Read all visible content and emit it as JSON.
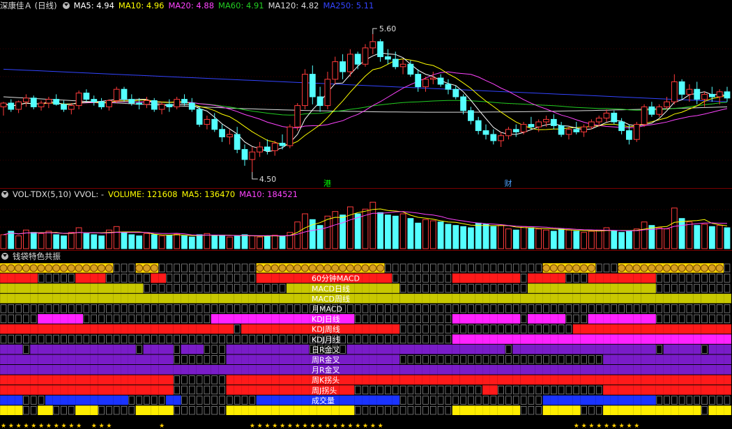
{
  "main_header": {
    "stock": "深康佳Ａ (日线)",
    "ma5": "MA5: 4.94",
    "ma10": "MA10: 4.96",
    "ma20": "MA20: 4.88",
    "ma60": "MA60: 4.91",
    "ma120": "MA120: 4.82",
    "ma250": "MA250: 5.11"
  },
  "price_high_label": "5.60",
  "price_low_label": "4.50",
  "event_markers": [
    {
      "label": "港",
      "index": 43,
      "color": "#00ff00"
    },
    {
      "label": "财",
      "index": 67,
      "color": "#4fa3ff"
    }
  ],
  "volume_header": {
    "name": "VOL-TDX(5,10)",
    "vvol": "VVOL: -",
    "volume": "VOLUME: 121608",
    "ma5": "MA5: 136470",
    "ma10": "MA10: 184521"
  },
  "signal_header": {
    "title": "钱袋特色共振"
  },
  "colors": {
    "up": "#ff3b3b",
    "down": "#54ffff",
    "ma5": "#ffffff",
    "ma10": "#ffff00",
    "ma20": "#ff44ff",
    "ma60": "#22cc22",
    "ma120": "#dddddd",
    "ma250": "#3344ff",
    "grid_red": "#7a0000"
  },
  "chart_data": {
    "type": "candlestick",
    "price_range": [
      4.4,
      5.75
    ],
    "candles": [
      [
        5.02,
        5.06,
        4.95,
        5.05
      ],
      [
        5.05,
        5.08,
        4.98,
        5.0
      ],
      [
        5.0,
        5.07,
        4.97,
        5.06
      ],
      [
        5.06,
        5.12,
        5.02,
        5.09
      ],
      [
        5.09,
        5.11,
        5.0,
        5.02
      ],
      [
        5.02,
        5.07,
        4.99,
        5.05
      ],
      [
        5.05,
        5.1,
        5.01,
        5.08
      ],
      [
        5.08,
        5.12,
        5.03,
        5.04
      ],
      [
        5.04,
        5.07,
        4.98,
        5.0
      ],
      [
        5.0,
        5.05,
        4.96,
        5.03
      ],
      [
        5.03,
        5.15,
        5.0,
        5.13
      ],
      [
        5.13,
        5.16,
        5.06,
        5.08
      ],
      [
        5.08,
        5.11,
        5.03,
        5.06
      ],
      [
        5.06,
        5.09,
        5.0,
        5.02
      ],
      [
        5.02,
        5.08,
        4.99,
        5.07
      ],
      [
        5.07,
        5.18,
        5.05,
        5.16
      ],
      [
        5.16,
        5.18,
        5.06,
        5.08
      ],
      [
        5.08,
        5.12,
        5.03,
        5.05
      ],
      [
        5.05,
        5.09,
        5.0,
        5.04
      ],
      [
        5.04,
        5.1,
        5.01,
        5.07
      ],
      [
        5.07,
        5.09,
        4.98,
        5.0
      ],
      [
        5.0,
        5.06,
        4.96,
        5.04
      ],
      [
        5.04,
        5.08,
        4.98,
        5.02
      ],
      [
        5.02,
        5.1,
        5.0,
        5.08
      ],
      [
        5.08,
        5.12,
        5.03,
        5.05
      ],
      [
        5.05,
        5.09,
        4.98,
        5.0
      ],
      [
        5.0,
        5.02,
        4.86,
        4.88
      ],
      [
        4.88,
        4.95,
        4.84,
        4.92
      ],
      [
        4.92,
        4.97,
        4.82,
        4.84
      ],
      [
        4.84,
        4.88,
        4.74,
        4.78
      ],
      [
        4.78,
        4.84,
        4.72,
        4.8
      ],
      [
        4.8,
        4.86,
        4.65,
        4.68
      ],
      [
        4.68,
        4.72,
        4.55,
        4.6
      ],
      [
        4.6,
        4.7,
        4.5,
        4.66
      ],
      [
        4.66,
        4.74,
        4.62,
        4.7
      ],
      [
        4.7,
        4.76,
        4.64,
        4.67
      ],
      [
        4.67,
        4.75,
        4.63,
        4.73
      ],
      [
        4.73,
        4.8,
        4.68,
        4.71
      ],
      [
        4.71,
        4.88,
        4.69,
        4.86
      ],
      [
        4.86,
        5.05,
        4.83,
        5.03
      ],
      [
        5.03,
        5.32,
        5.0,
        5.28
      ],
      [
        5.28,
        5.35,
        5.04,
        5.1
      ],
      [
        5.1,
        5.18,
        4.98,
        5.03
      ],
      [
        5.03,
        5.3,
        5.0,
        5.24
      ],
      [
        5.24,
        5.42,
        5.2,
        5.38
      ],
      [
        5.38,
        5.44,
        5.24,
        5.3
      ],
      [
        5.3,
        5.48,
        5.26,
        5.44
      ],
      [
        5.44,
        5.46,
        5.32,
        5.36
      ],
      [
        5.36,
        5.52,
        5.34,
        5.49
      ],
      [
        5.49,
        5.6,
        5.44,
        5.54
      ],
      [
        5.54,
        5.56,
        5.38,
        5.42
      ],
      [
        5.42,
        5.48,
        5.36,
        5.4
      ],
      [
        5.4,
        5.46,
        5.32,
        5.34
      ],
      [
        5.34,
        5.4,
        5.28,
        5.36
      ],
      [
        5.36,
        5.39,
        5.26,
        5.28
      ],
      [
        5.28,
        5.32,
        5.14,
        5.18
      ],
      [
        5.18,
        5.26,
        5.14,
        5.24
      ],
      [
        5.24,
        5.3,
        5.2,
        5.25
      ],
      [
        5.25,
        5.28,
        5.18,
        5.2
      ],
      [
        5.2,
        5.24,
        5.12,
        5.16
      ],
      [
        5.16,
        5.19,
        5.08,
        5.1
      ],
      [
        5.1,
        5.12,
        4.96,
        4.99
      ],
      [
        4.99,
        5.02,
        4.88,
        4.91
      ],
      [
        4.91,
        4.94,
        4.8,
        4.83
      ],
      [
        4.83,
        4.88,
        4.76,
        4.8
      ],
      [
        4.8,
        4.84,
        4.72,
        4.75
      ],
      [
        4.75,
        4.82,
        4.7,
        4.79
      ],
      [
        4.79,
        4.86,
        4.76,
        4.84
      ],
      [
        4.84,
        4.88,
        4.78,
        4.82
      ],
      [
        4.82,
        4.9,
        4.8,
        4.88
      ],
      [
        4.88,
        4.94,
        4.84,
        4.86
      ],
      [
        4.86,
        4.92,
        4.82,
        4.9
      ],
      [
        4.9,
        4.95,
        4.86,
        4.92
      ],
      [
        4.92,
        4.96,
        4.84,
        4.87
      ],
      [
        4.87,
        4.9,
        4.78,
        4.8
      ],
      [
        4.8,
        4.86,
        4.76,
        4.84
      ],
      [
        4.84,
        4.9,
        4.8,
        4.82
      ],
      [
        4.82,
        4.88,
        4.78,
        4.86
      ],
      [
        4.86,
        4.92,
        4.84,
        4.9
      ],
      [
        4.9,
        4.95,
        4.86,
        4.93
      ],
      [
        4.93,
        5.0,
        4.9,
        4.97
      ],
      [
        4.97,
        4.99,
        4.88,
        4.9
      ],
      [
        4.9,
        4.93,
        4.8,
        4.83
      ],
      [
        4.83,
        4.88,
        4.72,
        4.76
      ],
      [
        4.76,
        4.9,
        4.74,
        4.88
      ],
      [
        4.88,
        5.04,
        4.86,
        5.02
      ],
      [
        5.02,
        5.06,
        4.94,
        4.96
      ],
      [
        4.96,
        5.04,
        4.94,
        5.02
      ],
      [
        5.02,
        5.1,
        5.0,
        5.06
      ],
      [
        5.06,
        5.28,
        5.04,
        5.22
      ],
      [
        5.22,
        5.24,
        5.08,
        5.12
      ],
      [
        5.12,
        5.2,
        5.06,
        5.16
      ],
      [
        5.16,
        5.22,
        5.04,
        5.08
      ],
      [
        5.08,
        5.14,
        5.02,
        5.12
      ],
      [
        5.12,
        5.18,
        5.06,
        5.1
      ],
      [
        5.1,
        5.16,
        5.04,
        5.14
      ],
      [
        5.14,
        5.18,
        5.06,
        5.09
      ]
    ],
    "volume": {
      "volumes": [
        120,
        150,
        110,
        160,
        140,
        130,
        150,
        120,
        110,
        140,
        180,
        130,
        120,
        110,
        160,
        190,
        140,
        120,
        110,
        130,
        120,
        110,
        115,
        125,
        110,
        100,
        120,
        130,
        110,
        115,
        100,
        110,
        120,
        110,
        100,
        105,
        115,
        110,
        140,
        230,
        300,
        250,
        200,
        280,
        320,
        290,
        360,
        300,
        340,
        400,
        310,
        290,
        280,
        300,
        260,
        220,
        250,
        240,
        230,
        210,
        200,
        190,
        180,
        220,
        210,
        190,
        200,
        170,
        160,
        190,
        180,
        170,
        160,
        150,
        170,
        160,
        150,
        140,
        150,
        160,
        180,
        150,
        140,
        150,
        170,
        230,
        200,
        180,
        170,
        350,
        260,
        230,
        200,
        210,
        190,
        200,
        180
      ],
      "ma5": [
        136470
      ],
      "ma10": [
        184521
      ]
    },
    "signal_rows": [
      {
        "label": "",
        "color": "#ffd800"
      },
      {
        "label": "60分钟MACD",
        "color": "#ff1a1a"
      },
      {
        "label": "MACD日线",
        "color": "#c8c800"
      },
      {
        "label": "MACD周线",
        "color": "#c8c800"
      },
      {
        "label": "月MACD",
        "color": "#ff1a1a"
      },
      {
        "label": "KDJ日线",
        "color": "#ff22ff"
      },
      {
        "label": "KDJ周线",
        "color": "#ff1a1a"
      },
      {
        "label": "KDJ月线",
        "color": "#ff22ff"
      },
      {
        "label": "日R金叉",
        "color": "#7a1cc8"
      },
      {
        "label": "周R金叉",
        "color": "#7a1cc8"
      },
      {
        "label": "月R金叉",
        "color": "#7a1cc8"
      },
      {
        "label": "周K拐头",
        "color": "#ff1a1a"
      },
      {
        "label": "周J拐头",
        "color": "#ff1a1a"
      },
      {
        "label": "成交量",
        "color": "#1a33ff"
      },
      {
        "label": "",
        "color": "#ffee00"
      }
    ]
  }
}
